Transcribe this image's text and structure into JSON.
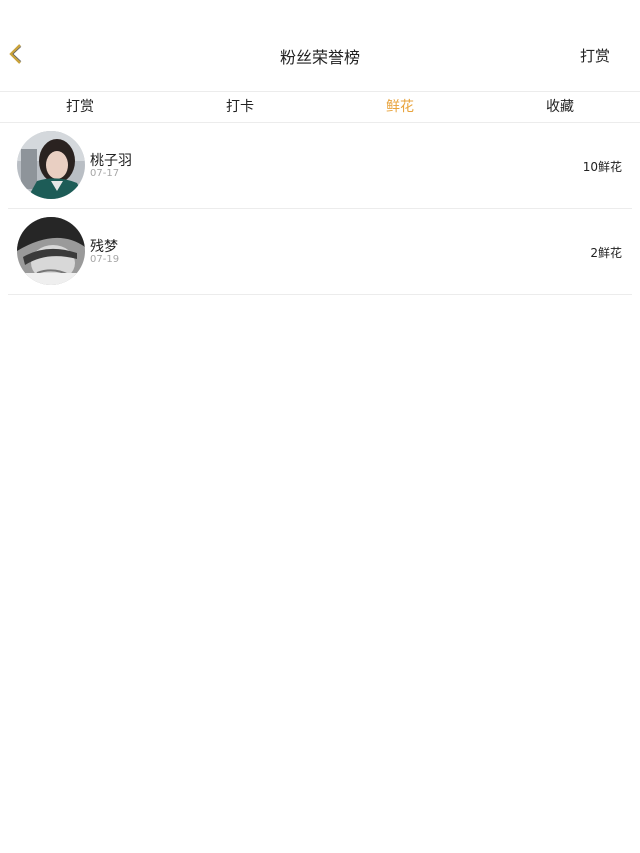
{
  "nav": {
    "title": "粉丝荣誉榜",
    "action_label": "打赏",
    "accent_color": "#e8a33c"
  },
  "tabs": [
    {
      "label": "打赏",
      "active": false
    },
    {
      "label": "打卡",
      "active": false
    },
    {
      "label": "鲜花",
      "active": true
    },
    {
      "label": "收藏",
      "active": false
    }
  ],
  "fans": [
    {
      "name": "桃子羽",
      "date": "07-17",
      "count": "10鲜花",
      "avatar": "user-photo"
    },
    {
      "name": "残梦",
      "date": "07-19",
      "count": "2鲜花",
      "avatar": "user-photo"
    }
  ]
}
